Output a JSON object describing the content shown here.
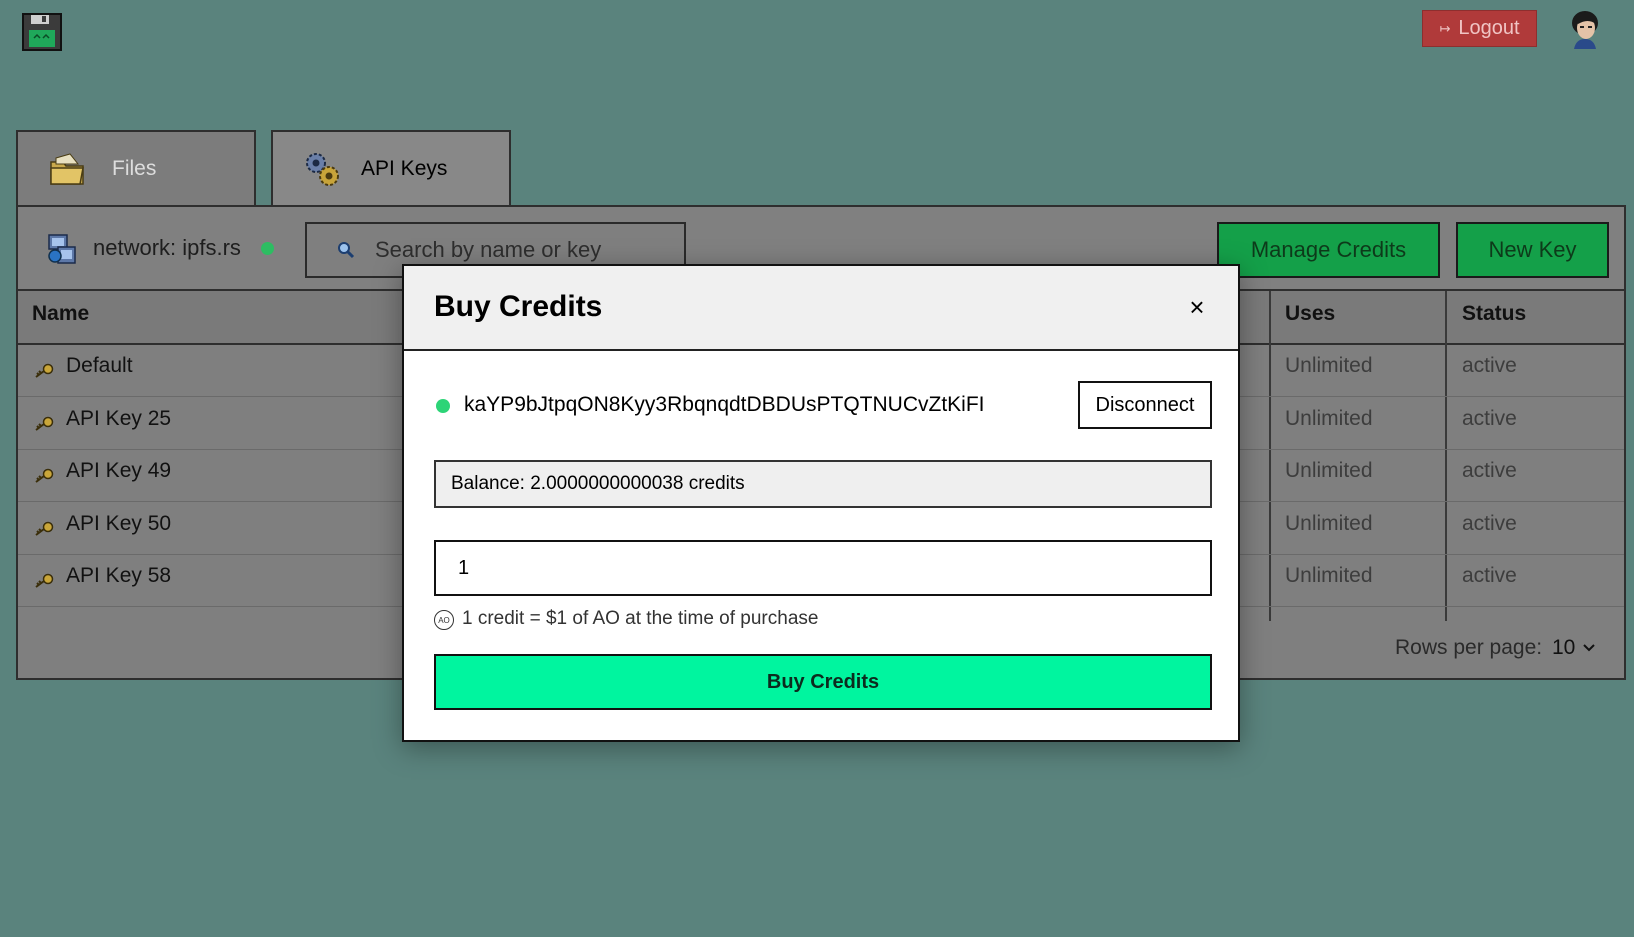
{
  "header": {
    "logout_label": "Logout"
  },
  "tabs": [
    {
      "label": "Files",
      "icon": "folder-icon"
    },
    {
      "label": "API Keys",
      "icon": "gears-icon"
    }
  ],
  "toolbar": {
    "network_label": "network: ipfs.rs",
    "network_status_color": "#2dbd62",
    "search_placeholder": "Search by name or key",
    "manage_credits_label": "Manage Credits",
    "new_key_label": "New Key"
  },
  "table": {
    "columns": {
      "name": "Name",
      "uses": "Uses",
      "status": "Status"
    },
    "rows": [
      {
        "name": "Default",
        "uses": "Unlimited",
        "status": "active"
      },
      {
        "name": "API Key 25",
        "uses": "Unlimited",
        "status": "active"
      },
      {
        "name": "API Key 49",
        "uses": "Unlimited",
        "status": "active"
      },
      {
        "name": "API Key 50",
        "uses": "Unlimited",
        "status": "active"
      },
      {
        "name": "API Key 58",
        "uses": "Unlimited",
        "status": "active"
      }
    ],
    "rows_per_page_label": "Rows per page:",
    "rows_per_page_value": "10"
  },
  "modal": {
    "title": "Buy Credits",
    "close_label": "×",
    "wallet_address": "kaYP9bJtpqON8Kyy3RbqnqdtDBDUsPTQTNUCvZtKiFI",
    "wallet_status_color": "#2dd477",
    "disconnect_label": "Disconnect",
    "balance_text": "Balance: 2.0000000000038 credits",
    "amount_value": "1",
    "rate_icon_text": "AO",
    "rate_note": "1 credit = $1 of AO at the time of purchase",
    "buy_label": "Buy Credits",
    "buy_color": "#00f59f"
  },
  "colors": {
    "background": "#5a837d",
    "logout": "#b03a3a",
    "green_button": "#14a049"
  }
}
